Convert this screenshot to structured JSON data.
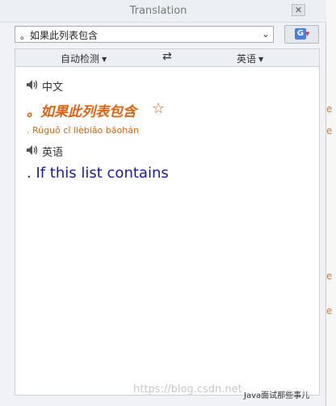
{
  "window": {
    "title": "Translation",
    "close_label": "✕"
  },
  "source": {
    "value": "。如果此列表包含"
  },
  "languages": {
    "from": "自动检测",
    "to": "英语",
    "swap_glyph": "⇄"
  },
  "result": {
    "source_language_label": "中文",
    "source_text": "。如果此列表包含",
    "pinyin": ". Rúguǒ cǐ lièbiǎo bāohán",
    "target_language_label": "英语",
    "translation": ". If this list contains"
  },
  "watermark": {
    "url": "https://blog.csdn.net",
    "brand": "Java面试那些事儿"
  }
}
